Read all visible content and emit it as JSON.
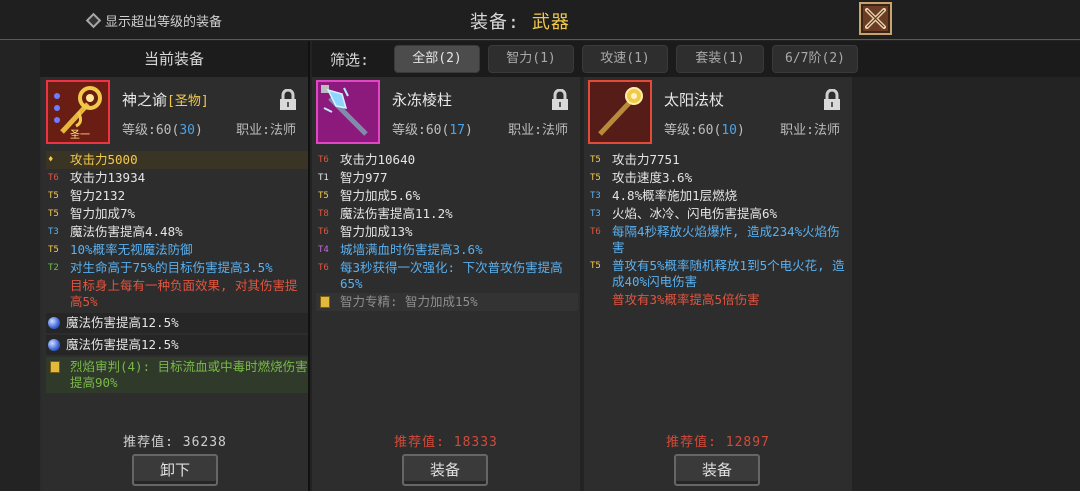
{
  "header": {
    "show_over_level_label": "显示超出等级的装备",
    "title_label": "装备:",
    "category": "武器"
  },
  "equipped_header": "当前装备",
  "filter": {
    "label": "筛选:",
    "buttons": [
      "全部(2)",
      "智力(1)",
      "攻速(1)",
      "套装(1)",
      "6/7阶(2)"
    ]
  },
  "cards": [
    {
      "name": "神之谕",
      "tag": "[圣物]",
      "badge": "圣一",
      "level_label": "等级:60(",
      "level_value": "30",
      "level_close": ")",
      "job": "职业:法师",
      "stats": [
        {
          "tier": "♦",
          "text": "攻击力5000",
          "color": "yellow",
          "style": "hl"
        },
        {
          "tier": "T6",
          "text": "攻击力13934",
          "color": "white",
          "tcolor": "red"
        },
        {
          "tier": "T5",
          "text": "智力2132",
          "color": "white",
          "tcolor": "yellow"
        },
        {
          "tier": "T5",
          "text": "智力加成7%",
          "color": "white",
          "tcolor": "yellow"
        },
        {
          "tier": "T3",
          "text": "魔法伤害提高4.48%",
          "color": "white",
          "tcolor": "blue"
        },
        {
          "tier": "T5",
          "text": "10%概率无视魔法防御",
          "color": "blue",
          "tcolor": "yellow"
        },
        {
          "tier": "T2",
          "text": "对生命高于75%的目标伤害提高3.5%",
          "color": "blue",
          "tcolor": "green"
        },
        {
          "tier": "",
          "text": "目标身上每有一种负面效果, 对其伤害提高5%",
          "color": "red"
        },
        {
          "tier": "orb",
          "text": "魔法伤害提高12.5%",
          "color": "white",
          "style": "gem"
        },
        {
          "tier": "orb",
          "text": "魔法伤害提高12.5%",
          "color": "white",
          "style": "gem"
        },
        {
          "tier": "book",
          "text": "烈焰审判(4): 目标流血或中毒时燃烧伤害提高90%",
          "color": "olive",
          "style": "set"
        }
      ],
      "recommend": "推荐值: 36238",
      "button": "卸下"
    },
    {
      "name": "永冻棱柱",
      "badge": "",
      "level_label": "等级:60(",
      "level_value": "17",
      "level_close": ")",
      "job": "职业:法师",
      "stats": [
        {
          "tier": "T6",
          "text": "攻击力10640",
          "color": "white",
          "tcolor": "red"
        },
        {
          "tier": "T1",
          "text": "智力977",
          "color": "white",
          "tcolor": "white"
        },
        {
          "tier": "T5",
          "text": "智力加成5.6%",
          "color": "white",
          "tcolor": "yellow"
        },
        {
          "tier": "T8",
          "text": "魔法伤害提高11.2%",
          "color": "white",
          "tcolor": "red"
        },
        {
          "tier": "T6",
          "text": "智力加成13%",
          "color": "white",
          "tcolor": "red"
        },
        {
          "tier": "T4",
          "text": "城墙满血时伤害提高3.6%",
          "color": "blue",
          "tcolor": "purple"
        },
        {
          "tier": "T6",
          "text": "每3秒获得一次强化: 下次普攻伤害提高65%",
          "color": "blue",
          "tcolor": "red"
        },
        {
          "tier": "book",
          "text": "智力专精: 智力加成15%",
          "color": "gray",
          "style": "dim"
        }
      ],
      "recommend": "推荐值: 18333",
      "button": "装备"
    },
    {
      "name": "太阳法杖",
      "badge": "",
      "level_label": "等级:60(",
      "level_value": "10",
      "level_close": ")",
      "job": "职业:法师",
      "stats": [
        {
          "tier": "T5",
          "text": "攻击力7751",
          "color": "white",
          "tcolor": "yellow"
        },
        {
          "tier": "T5",
          "text": "攻击速度3.6%",
          "color": "white",
          "tcolor": "yellow"
        },
        {
          "tier": "T3",
          "text": "4.8%概率施加1层燃烧",
          "color": "white",
          "tcolor": "blue"
        },
        {
          "tier": "T3",
          "text": "火焰、冰冷、闪电伤害提高6%",
          "color": "white",
          "tcolor": "blue"
        },
        {
          "tier": "T6",
          "text": "每隔4秒释放火焰爆炸, 造成234%火焰伤害",
          "color": "blue",
          "tcolor": "red"
        },
        {
          "tier": "T5",
          "text": "普攻有5%概率随机释放1到5个电火花, 造成40%闪电伤害",
          "color": "blue",
          "tcolor": "yellow"
        },
        {
          "tier": "",
          "text": "普攻有3%概率提高5倍伤害",
          "color": "red"
        }
      ],
      "recommend": "推荐值: 12897",
      "button": "装备"
    }
  ]
}
